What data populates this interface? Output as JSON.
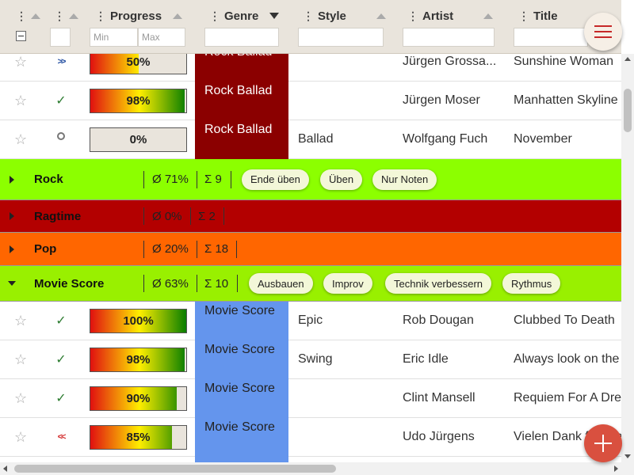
{
  "header": {
    "columns": {
      "progress": "Progress",
      "genre": "Genre",
      "style": "Style",
      "artist": "Artist",
      "title": "Title"
    },
    "drag_handle": "⋮",
    "filters": {
      "progress_min_placeholder": "Min",
      "progress_max_placeholder": "Max"
    }
  },
  "rows_top": [
    {
      "status": "play",
      "progress": 50,
      "progress_label": "50%",
      "genre": "Rock Ballad",
      "style": "",
      "artist": "Jürgen Grossa...",
      "title": "Sunshine Woman"
    },
    {
      "status": "done",
      "progress": 98,
      "progress_label": "98%",
      "genre": "Rock Ballad",
      "style": "",
      "artist": "Jürgen Moser",
      "title": "Manhatten Skyline"
    },
    {
      "status": "todo",
      "progress": 0,
      "progress_label": "0%",
      "genre": "Rock Ballad",
      "style": "Ballad",
      "artist": "Wolfgang Fuch",
      "title": "November"
    }
  ],
  "groups": [
    {
      "name": "Rock",
      "avg": "Ø 71%",
      "count": "Σ 9",
      "color": "#8cff00",
      "expanded": false,
      "chips": [
        "Ende üben",
        "Üben",
        "Nur Noten"
      ]
    },
    {
      "name": "Ragtime",
      "avg": "Ø 0%",
      "count": "Σ 2",
      "color": "#b30000",
      "expanded": false,
      "chips": []
    },
    {
      "name": "Pop",
      "avg": "Ø 20%",
      "count": "Σ 18",
      "color": "#ff6600",
      "expanded": false,
      "chips": []
    },
    {
      "name": "Movie Score",
      "avg": "Ø 63%",
      "count": "Σ 10",
      "color": "#99f000",
      "expanded": true,
      "chips": [
        "Ausbauen",
        "Improv",
        "Technik verbessern",
        "Rythmus"
      ]
    }
  ],
  "rows_movie": [
    {
      "status": "done",
      "progress": 100,
      "progress_label": "100%",
      "genre": "Movie Score",
      "style": "Epic",
      "artist": "Rob Dougan",
      "title": "Clubbed To Death"
    },
    {
      "status": "done",
      "progress": 98,
      "progress_label": "98%",
      "genre": "Movie Score",
      "style": "Swing",
      "artist": "Eric Idle",
      "title": "Always look on the"
    },
    {
      "status": "done",
      "progress": 90,
      "progress_label": "90%",
      "genre": "Movie Score",
      "style": "",
      "artist": "Clint Mansell",
      "title": "Requiem For A Drea"
    },
    {
      "status": "rewind",
      "progress": 85,
      "progress_label": "85%",
      "genre": "Movie Score",
      "style": "",
      "artist": "Udo Jürgens",
      "title": "Vielen Dank für Die"
    }
  ],
  "colors": {
    "rock_ballad": "#8b0000",
    "movie_score": "#6495ed",
    "fab_add": "#d9503f",
    "menu_lines": "#c62828"
  },
  "icons": {
    "favorite": "star-outline-icon",
    "menu": "hamburger-icon",
    "add": "plus-icon"
  }
}
